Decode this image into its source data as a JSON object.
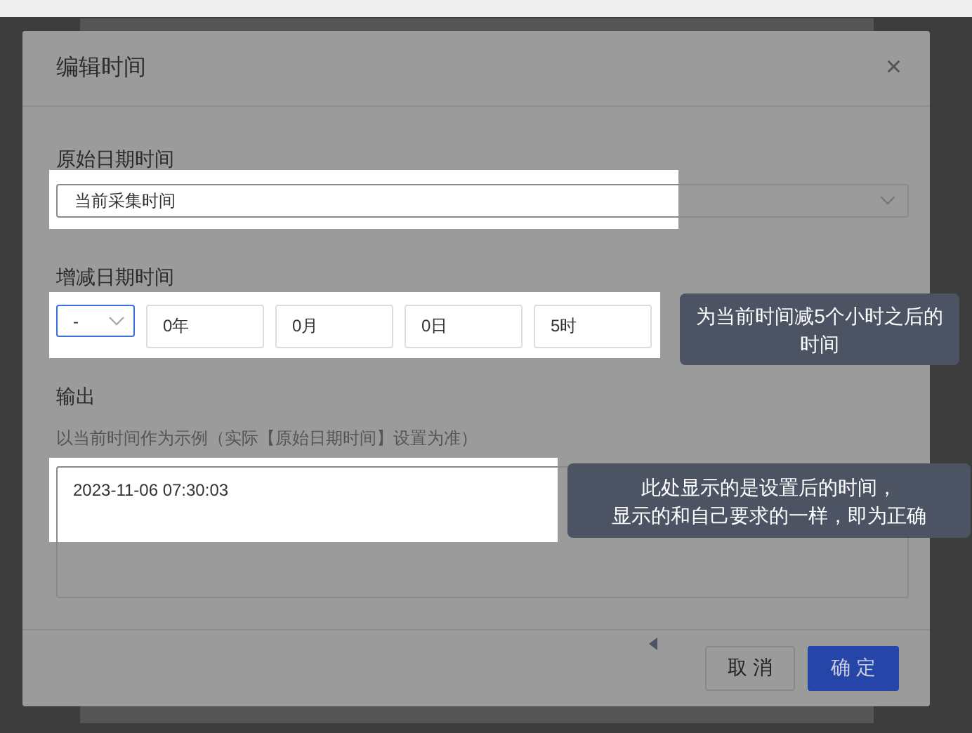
{
  "dialog": {
    "title": "编辑时间",
    "close": "×"
  },
  "original_datetime": {
    "label": "原始日期时间",
    "value": "当前采集时间"
  },
  "offset": {
    "label": "增减日期时间",
    "sign": {
      "value": "-",
      "focused": true
    },
    "parts": [
      "0年",
      "0月",
      "0日",
      "5时"
    ]
  },
  "output": {
    "label": "输出",
    "hint": "以当前时间作为示例（实际【原始日期时间】设置为准）",
    "value": "2023-11-06 07:30:03"
  },
  "tooltips": [
    {
      "lines": [
        "为当前时间减5个小时之后的",
        "时间"
      ]
    },
    {
      "lines": [
        "此处显示的是设置后的时间，",
        "显示的和自己要求的一样，即为正确"
      ]
    }
  ],
  "buttons": [
    {
      "label": "取 消",
      "kind": "secondary"
    },
    {
      "label": "确 定",
      "kind": "primary"
    }
  ]
}
